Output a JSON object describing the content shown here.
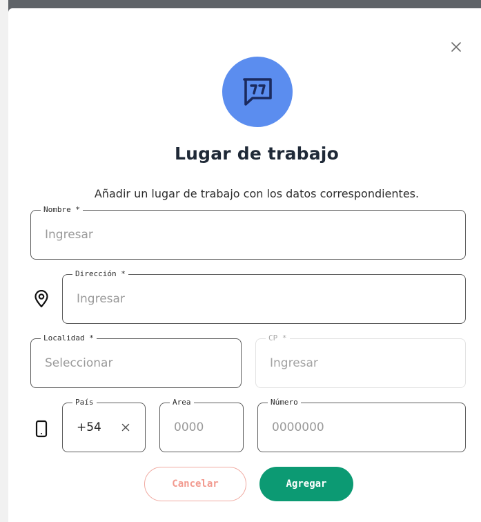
{
  "dialog": {
    "title": "Lugar de trabajo",
    "subtitle": "Añadir un lugar de trabajo con los datos correspondientes.",
    "close_icon": "close-icon",
    "hero_icon": "chat-quote-icon",
    "hero_color": "#5b8def"
  },
  "form": {
    "nombre": {
      "label": "Nombre *",
      "placeholder": "Ingresar"
    },
    "direccion": {
      "label": "Dirección *",
      "placeholder": "Ingresar",
      "icon": "location-pin-icon"
    },
    "localidad": {
      "label": "Localidad *",
      "placeholder": "Seleccionar"
    },
    "cp": {
      "label": "CP *",
      "placeholder": "Ingresar"
    },
    "phone": {
      "icon": "mobile-phone-icon",
      "pais": {
        "label": "País",
        "value": "+54"
      },
      "area": {
        "label": "Area",
        "placeholder": "0000"
      },
      "numero": {
        "label": "Número",
        "placeholder": "0000000"
      }
    }
  },
  "actions": {
    "cancel_label": "Cancelar",
    "submit_label": "Agregar",
    "submit_color": "#0c9a73",
    "cancel_color": "#f29a8f"
  }
}
